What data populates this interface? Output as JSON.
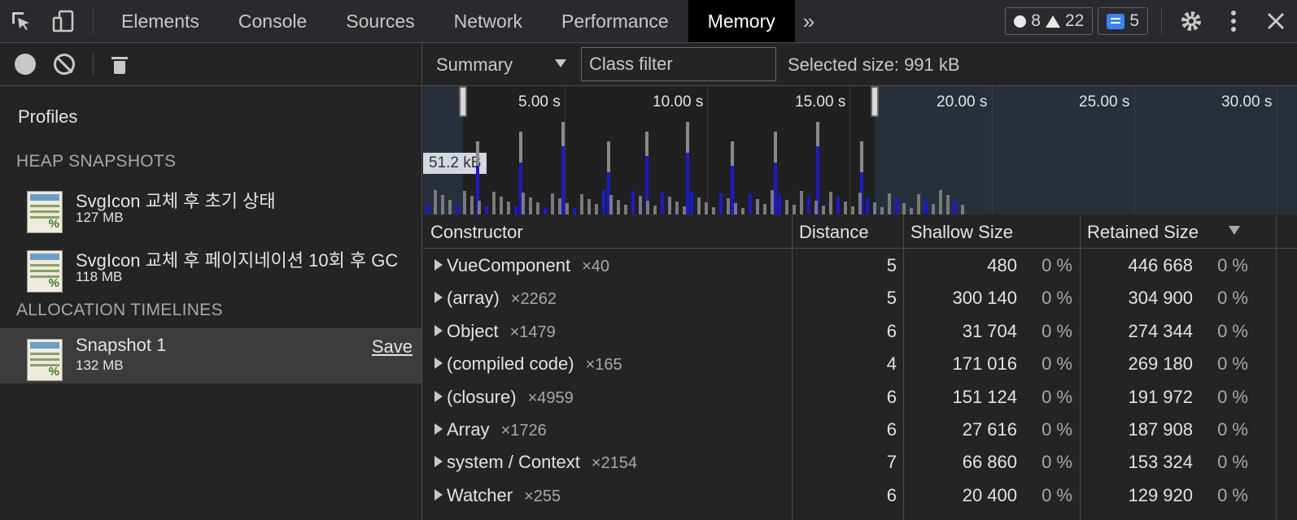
{
  "tabs": [
    {
      "label": "Elements"
    },
    {
      "label": "Console"
    },
    {
      "label": "Sources"
    },
    {
      "label": "Network"
    },
    {
      "label": "Performance"
    },
    {
      "label": "Memory",
      "active": true
    }
  ],
  "badges": {
    "errors": "8",
    "warnings": "22",
    "messages": "5"
  },
  "sidebar": {
    "title": "Profiles",
    "heap_section": "HEAP SNAPSHOTS",
    "allocation_section": "ALLOCATION TIMELINES",
    "heap_items": [
      {
        "name": "SvgIcon 교체 후 초기 상태",
        "size": "127 MB"
      },
      {
        "name": "SvgIcon 교체 후 페이지네이션 10회 후 GC",
        "size": "118 MB"
      }
    ],
    "allocation_items": [
      {
        "name": "Snapshot 1",
        "size": "132 MB",
        "action": "Save"
      }
    ]
  },
  "toolbar": {
    "view": "Summary",
    "class_filter_placeholder": "Class filter",
    "selected_size": "Selected size: 991 kB"
  },
  "timeline": {
    "ticks": [
      "5.00 s",
      "10.00 s",
      "15.00 s",
      "20.00 s",
      "25.00 s",
      "30.00 s"
    ],
    "scale_label": "51.2 kB"
  },
  "table": {
    "headers": {
      "constructor": "Constructor",
      "distance": "Distance",
      "shallow": "Shallow Size",
      "retained": "Retained Size"
    },
    "rows": [
      {
        "name": "VueComponent",
        "count": "×40",
        "distance": "5",
        "shallow": "480",
        "shallow_pct": "0 %",
        "retained": "446 668",
        "retained_pct": "0 %"
      },
      {
        "name": "(array)",
        "count": "×2262",
        "distance": "5",
        "shallow": "300 140",
        "shallow_pct": "0 %",
        "retained": "304 900",
        "retained_pct": "0 %"
      },
      {
        "name": "Object",
        "count": "×1479",
        "distance": "6",
        "shallow": "31 704",
        "shallow_pct": "0 %",
        "retained": "274 344",
        "retained_pct": "0 %"
      },
      {
        "name": "(compiled code)",
        "count": "×165",
        "distance": "4",
        "shallow": "171 016",
        "shallow_pct": "0 %",
        "retained": "269 180",
        "retained_pct": "0 %"
      },
      {
        "name": "(closure)",
        "count": "×4959",
        "distance": "6",
        "shallow": "151 124",
        "shallow_pct": "0 %",
        "retained": "191 972",
        "retained_pct": "0 %"
      },
      {
        "name": "Array",
        "count": "×1726",
        "distance": "6",
        "shallow": "27 616",
        "shallow_pct": "0 %",
        "retained": "187 908",
        "retained_pct": "0 %"
      },
      {
        "name": "system / Context",
        "count": "×2154",
        "distance": "7",
        "shallow": "66 860",
        "shallow_pct": "0 %",
        "retained": "153 324",
        "retained_pct": "0 %"
      },
      {
        "name": "Watcher",
        "count": "×255",
        "distance": "6",
        "shallow": "20 400",
        "shallow_pct": "0 %",
        "retained": "129 920",
        "retained_pct": "0 %"
      }
    ]
  },
  "colors": {
    "accent_blue": "#1a1acc",
    "bar_gray": "#8a8a8a",
    "active_tab_bg": "#000000"
  }
}
